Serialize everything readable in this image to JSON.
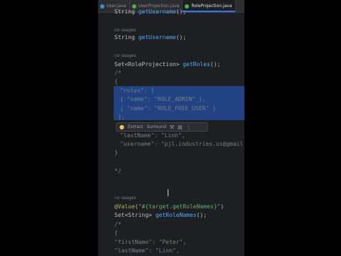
{
  "tabs": [
    {
      "label": "User.java",
      "color": "#3592c4",
      "active": false
    },
    {
      "label": "UserProjection.java",
      "color": "#4caf50",
      "active": false
    },
    {
      "label": "RoleProjection.java",
      "color": "#4caf50",
      "active": true
    }
  ],
  "code": {
    "l0": {
      "type": "String",
      "name": "getUsername",
      "tail": "();"
    },
    "hint1": "no usages",
    "l1": {
      "type": "String",
      "name": "getUsername",
      "tail": "();"
    },
    "hint2": "no usages",
    "l2": {
      "type": "Set<RoleProjection>",
      "name": "getRoles",
      "tail": "();"
    },
    "l3": "/*",
    "l4": "{",
    "l5": {
      "key": "\"roles\"",
      "rest": ": ["
    },
    "l6": {
      "open": "{ ",
      "key": "\"name\"",
      "sep": ": ",
      "val": "\"ROLE_ADMIN\"",
      "close": " },"
    },
    "l7": {
      "open": "{ ",
      "key": "\"name\"",
      "sep": ": ",
      "val": "\"ROLE_FREE_USER\"",
      "close": " }"
    },
    "l8": "],",
    "l9": {
      "key": "\"lastName\"",
      "rest": ": \"Linn\","
    },
    "l10": {
      "key": "\"username\"",
      "rest": ": \"pjl.industries.us@gmail.com\""
    },
    "l11": "}",
    "l12": "*/",
    "hint3": "no usages",
    "l13": {
      "ann": "@Value",
      "open": "(",
      "str": "\"#{target.getRoleNames}\"",
      "close": ")"
    },
    "l14": {
      "type": "Set<String>",
      "name": "getRoleNames",
      "tail": "();"
    },
    "l15": "/*",
    "l16": "{",
    "l17": {
      "key": "\"firstName\"",
      "rest": ": \"Peter\","
    },
    "l18": {
      "key": "\"lastName\"",
      "rest": ": \"Linn\","
    }
  },
  "popup": {
    "extract": "Extract",
    "surround": "Surround"
  }
}
